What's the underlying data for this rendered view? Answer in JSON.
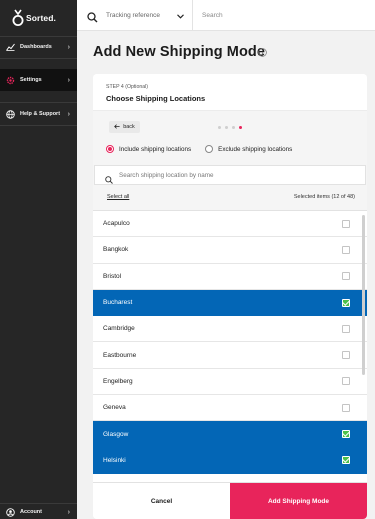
{
  "brand": {
    "name": "Sorted.",
    "accent": "#e8245b",
    "selected_row": "#0366b6",
    "check": "#4cc04c"
  },
  "sidebar": {
    "items": [
      {
        "label": "Dashboards",
        "icon": "chart-icon"
      },
      {
        "label": "Settings",
        "icon": "settings-icon",
        "active": true
      },
      {
        "label": "Help & Support",
        "icon": "globe-icon"
      }
    ],
    "account": {
      "label": "Account",
      "icon": "user-icon"
    }
  },
  "topbar": {
    "tracking_label": "Tracking reference",
    "search_label": "Search"
  },
  "page": {
    "title": "Add New Shipping Mode"
  },
  "wizard": {
    "step_label": "STEP 4 (Optional)",
    "step_title": "Choose Shipping Locations",
    "back_label": "back",
    "total_steps": 4,
    "current_step": 4,
    "radio_include": "Include shipping locations",
    "radio_exclude": "Exclude shipping locations",
    "radio_selected": "include",
    "search_placeholder": "Search shipping location by name",
    "select_all": "Select all",
    "selected_count": "Selected items (12 of 48)"
  },
  "locations": [
    {
      "name": "Acapulco",
      "selected": false
    },
    {
      "name": "Bangkok",
      "selected": false
    },
    {
      "name": "Bristol",
      "selected": false
    },
    {
      "name": "Bucharest",
      "selected": true
    },
    {
      "name": "Cambridge",
      "selected": false
    },
    {
      "name": "Eastbourne",
      "selected": false
    },
    {
      "name": "Engelberg",
      "selected": false
    },
    {
      "name": "Geneva",
      "selected": false
    },
    {
      "name": "Glasgow",
      "selected": true
    },
    {
      "name": "Helsinki",
      "selected": true
    }
  ],
  "footer": {
    "cancel_label": "Cancel",
    "add_label": "Add Shipping Mode"
  }
}
